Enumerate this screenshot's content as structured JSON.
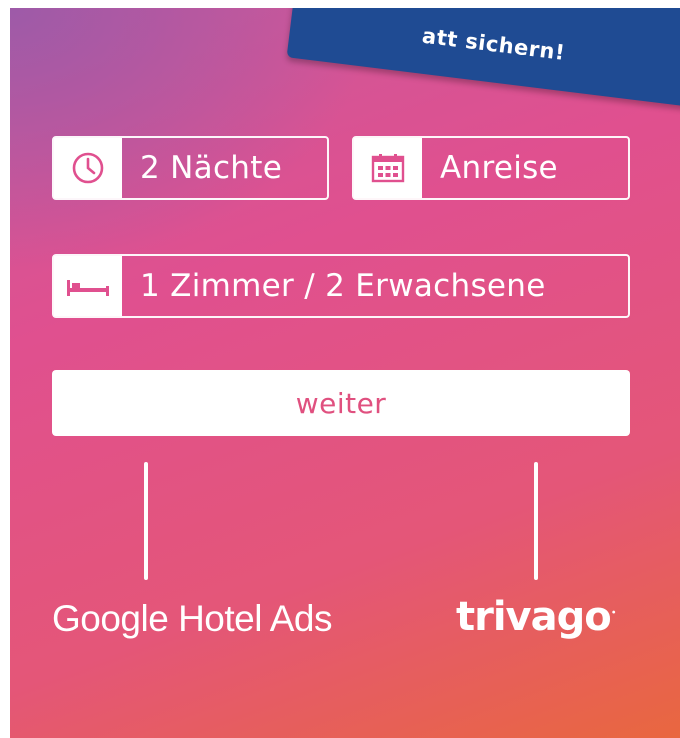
{
  "banner": {
    "text": "att sichern!"
  },
  "form": {
    "nights_label": "2 Nächte",
    "arrival_label": "Anreise",
    "rooms_label": "1 Zimmer / 2 Erwachsene",
    "submit_label": "weiter"
  },
  "footer": {
    "google_label": "Google Hotel Ads",
    "trivago_label": "trivago"
  },
  "colors": {
    "panel_gradient": [
      "#c8599c",
      "#e0508f",
      "#e45678",
      "#e9673f"
    ],
    "ribbon": "#1f4b93",
    "button_text": "#e0507f"
  },
  "icons": {
    "nights": "clock-icon",
    "arrival": "calendar-icon",
    "rooms": "bed-icon"
  }
}
